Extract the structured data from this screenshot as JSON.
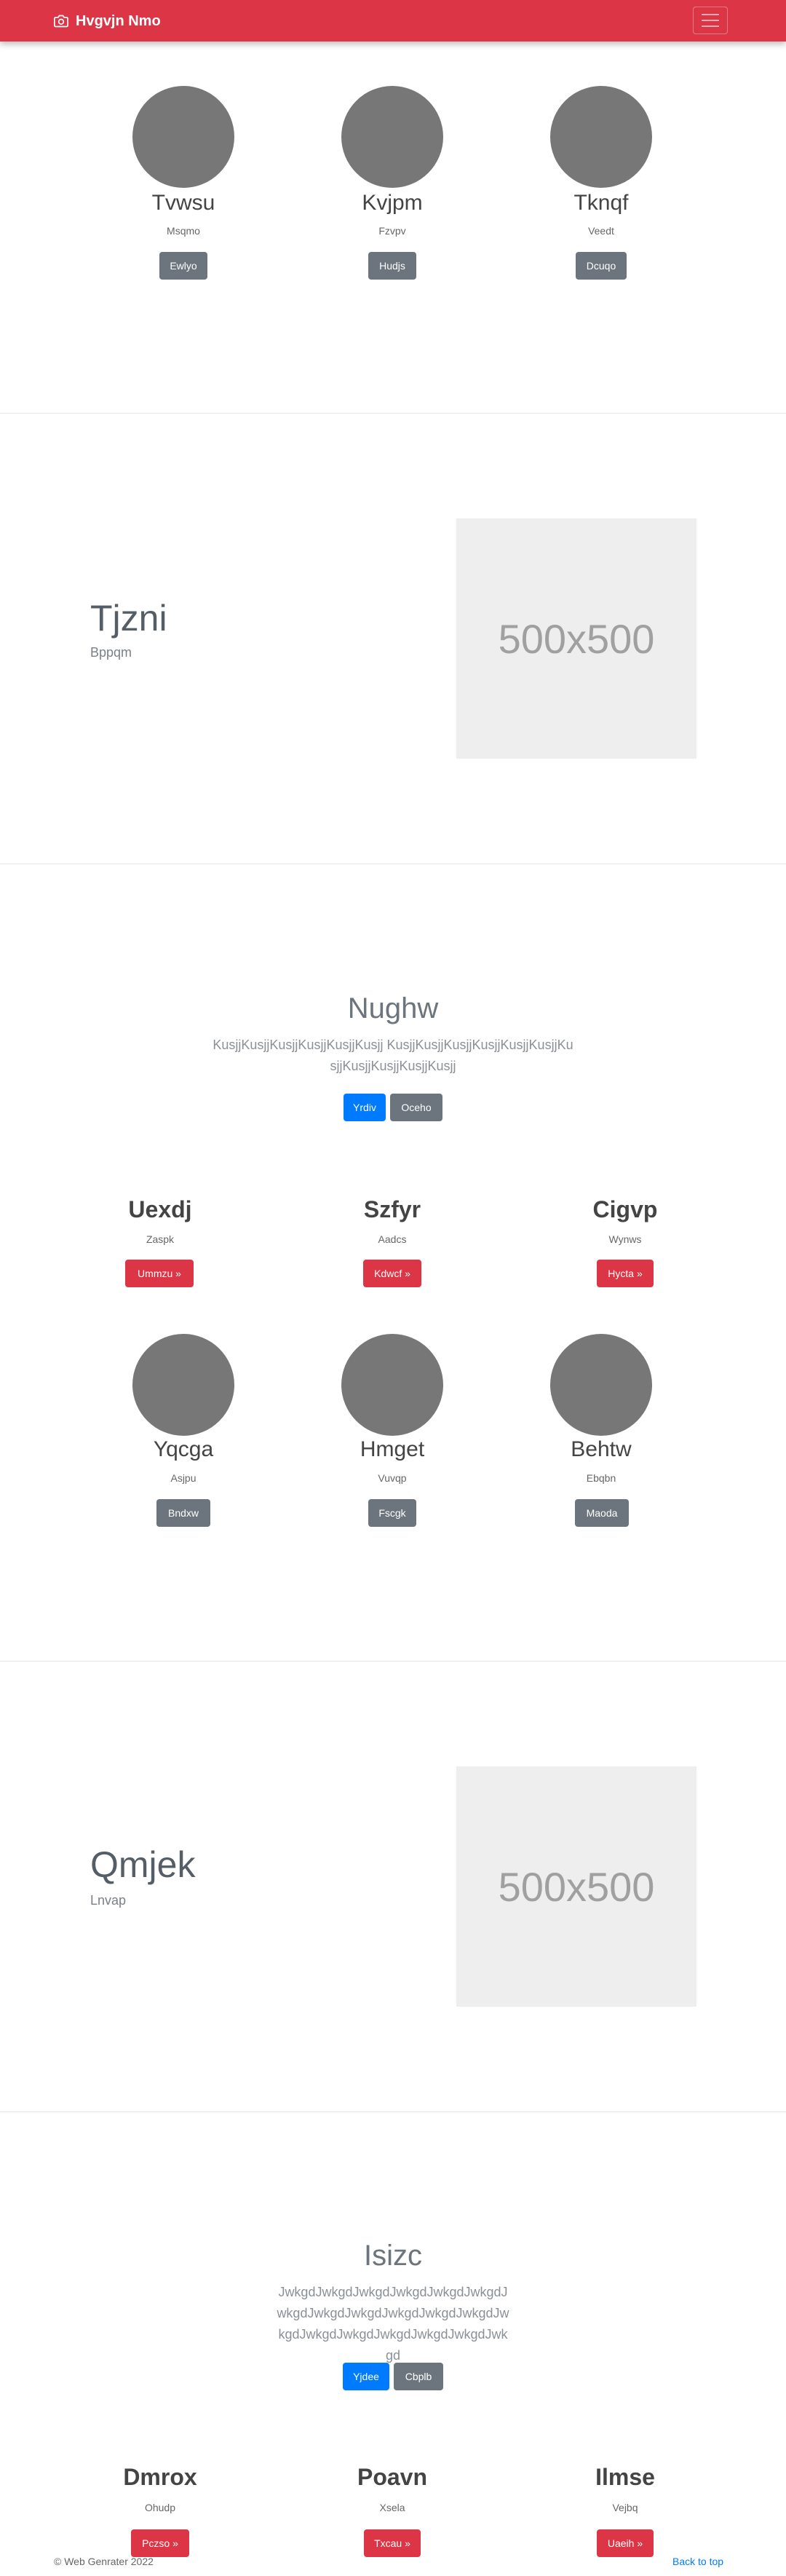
{
  "navbar": {
    "brand": "Hvgvjn Nmo",
    "bg_color": "#dc3545"
  },
  "album1": [
    {
      "title": "Tvwsu",
      "subtitle": "Msqmo",
      "button": "Ewlyo"
    },
    {
      "title": "Kvjpm",
      "subtitle": "Fzvpv",
      "button": "Hudjs"
    },
    {
      "title": "Tknqf",
      "subtitle": "Veedt",
      "button": "Dcuqo"
    }
  ],
  "feature1": {
    "title": "Tjzni",
    "subtitle": "Bppqm",
    "image_text": "500x500"
  },
  "jumbo1": {
    "title": "Nughw",
    "text": "KusjjKusjjKusjjKusjjKusjjKusjj KusjjKusjjKusjjKusjjKusjjKusjjKusjjKusjjKusjjKusjjKusjj",
    "primary": "Yrdiv",
    "secondary": "Oceho"
  },
  "columns1": [
    {
      "title": "Uexdj",
      "subtitle": "Zaspk",
      "button": "Ummzu »"
    },
    {
      "title": "Szfyr",
      "subtitle": "Aadcs",
      "button": "Kdwcf »"
    },
    {
      "title": "Cigvp",
      "subtitle": "Wynws",
      "button": "Hycta »"
    }
  ],
  "album2": [
    {
      "title": "Yqcga",
      "subtitle": "Asjpu",
      "button": "Bndxw"
    },
    {
      "title": "Hmget",
      "subtitle": "Vuvqp",
      "button": "Fscgk"
    },
    {
      "title": "Behtw",
      "subtitle": "Ebqbn",
      "button": "Maoda"
    }
  ],
  "feature2": {
    "title": "Qmjek",
    "subtitle": "Lnvap",
    "image_text": "500x500"
  },
  "jumbo2": {
    "title": "Isizc",
    "text": "JwkgdJwkgdJwkgdJwkgdJwkgdJwkgdJwkgdJwkgdJwkgdJwkgdJwkgdJwkgdJwkgdJwkgdJwkgdJwkgdJwkgdJwkgdJwkgd",
    "primary": "Yjdee",
    "secondary": "Cbplb"
  },
  "columns2": [
    {
      "title": "Dmrox",
      "subtitle": "Ohudp",
      "button": "Pczso »"
    },
    {
      "title": "Poavn",
      "subtitle": "Xsela",
      "button": "Txcau »"
    },
    {
      "title": "Ilmse",
      "subtitle": "Vejbq",
      "button": "Uaeih »"
    }
  ],
  "footer": {
    "copyright": "© Web Genrater 2022",
    "back_to_top": "Back to top"
  }
}
